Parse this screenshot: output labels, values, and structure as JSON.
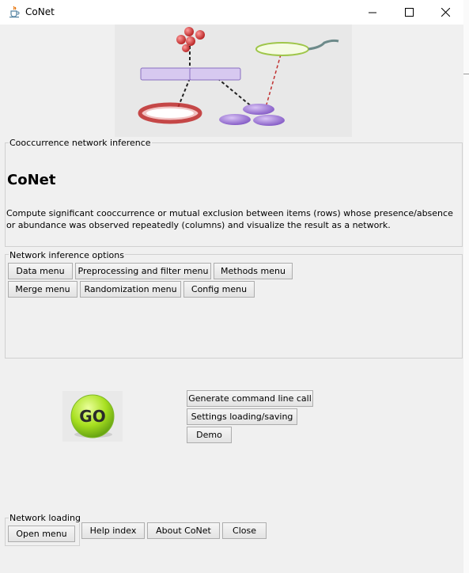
{
  "window": {
    "title": "CoNet"
  },
  "panels": {
    "inference": {
      "label": "Cooccurrence network inference",
      "heading": "CoNet",
      "description": "Compute significant cooccurrence or mutual exclusion between items (rows) whose presence/absence or abundance was observed repeatedly (columns) and visualize the result as a network."
    },
    "options": {
      "label": "Network inference options",
      "buttons": [
        "Data menu",
        "Preprocessing and filter menu",
        "Methods menu",
        "Merge menu",
        "Randomization menu",
        "Config menu"
      ]
    },
    "loading": {
      "label": "Network loading",
      "open_button": "Open menu"
    }
  },
  "actions": {
    "go": "GO",
    "generate": "Generate command line call",
    "settings": "Settings loading/saving",
    "demo": "Demo"
  },
  "bottom": {
    "help": "Help index",
    "about": "About CoNet",
    "close": "Close"
  },
  "colors": {
    "go_green": "#a8e020",
    "node_red": "#d63a3a",
    "node_purple": "#9a6fd0"
  },
  "icons": {
    "app": "java-cup-icon",
    "minimize": "minimize-icon",
    "maximize": "maximize-icon",
    "close": "close-icon"
  }
}
